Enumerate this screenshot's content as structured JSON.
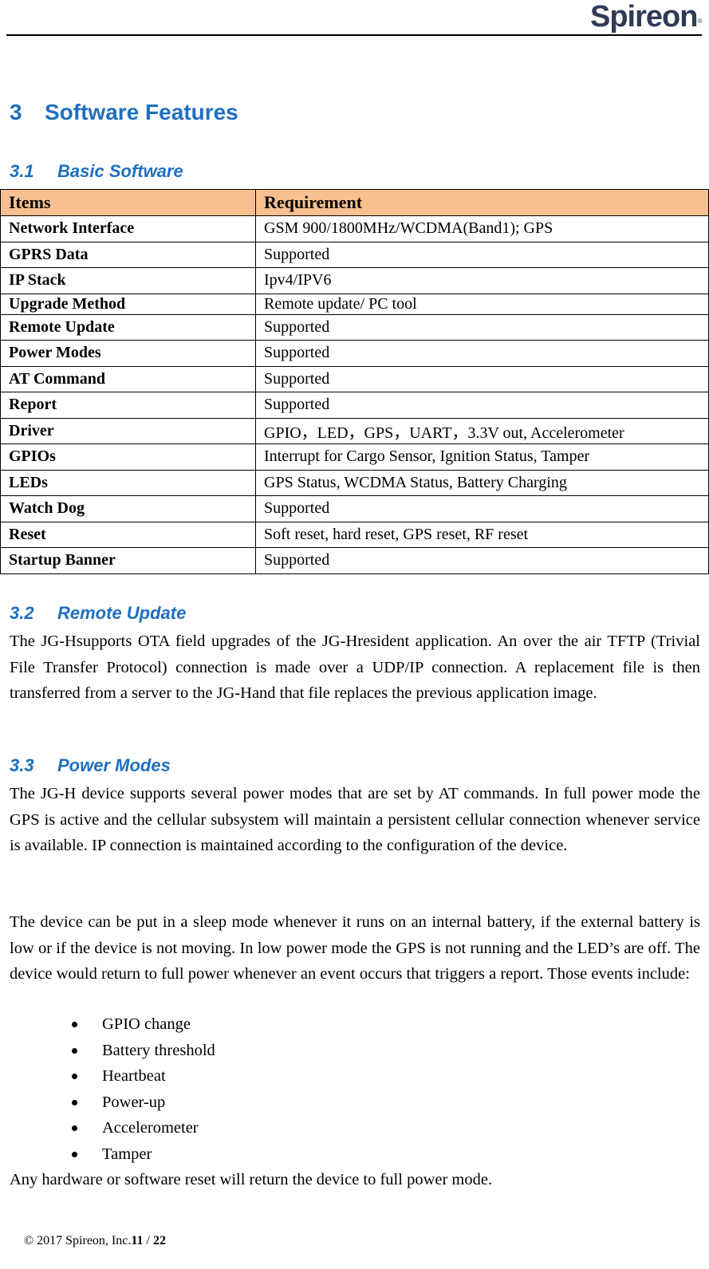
{
  "header": {
    "logo_text": "Spireon",
    "logo_accent_color": "#2f8fd1",
    "logo_color": "#2f3b55",
    "registered_mark": "®"
  },
  "section": {
    "number": "3",
    "title": "Software Features",
    "heading_color": "#1f6fbf"
  },
  "basic_software": {
    "number": "3.1",
    "title": "Basic Software",
    "table": {
      "header_color": "#f8c090",
      "columns": [
        "Items",
        "Requirement"
      ],
      "rows": [
        {
          "item": "Network Interface",
          "requirement": "GSM 900/1800MHz/WCDMA(Band1); GPS"
        },
        {
          "item": "GPRS Data",
          "requirement": "Supported"
        },
        {
          "item": "IP Stack",
          "requirement": "Ipv4/IPV6"
        },
        {
          "item": "Upgrade Method",
          "requirement": "Remote update/ PC tool"
        },
        {
          "item": "Remote Update",
          "requirement": "Supported"
        },
        {
          "item": "Power Modes",
          "requirement": "Supported"
        },
        {
          "item": "AT Command",
          "requirement": "Supported"
        },
        {
          "item": "Report",
          "requirement": "Supported"
        },
        {
          "item": "Driver",
          "requirement": "GPIO，LED，GPS，UART，3.3V out, Accelerometer"
        },
        {
          "item": "GPIOs",
          "requirement": "Interrupt for Cargo Sensor, Ignition Status, Tamper"
        },
        {
          "item": "LEDs",
          "requirement": "GPS Status, WCDMA Status, Battery Charging"
        },
        {
          "item": "Watch Dog",
          "requirement": "Supported"
        },
        {
          "item": "Reset",
          "requirement": "Soft reset, hard reset, GPS reset, RF reset"
        },
        {
          "item": "Startup Banner",
          "requirement": "Supported"
        }
      ]
    }
  },
  "remote_update": {
    "number": "3.2",
    "title": "Remote Update",
    "paragraph": "The JG-Hsupports OTA field upgrades of the JG-Hresident application. An over the air TFTP (Trivial File Transfer Protocol) connection is made over a UDP/IP connection. A replacement file is then transferred from a server to the JG-Hand that file replaces the previous application image."
  },
  "power_modes": {
    "number": "3.3",
    "title": "Power Modes",
    "paragraph1": "The JG-H device supports several power modes that are set by AT commands. In full power mode the GPS is active and the cellular subsystem will maintain a persistent cellular connection whenever service is available. IP connection is maintained according to the configuration of the device.",
    "paragraph2": "The device can be put in a sleep mode whenever it runs on an internal battery, if the external battery is low or if the device is not moving. In low power mode the GPS is not running and the LED’s are off. The device would return to full power whenever an event occurs that triggers a report. Those events include:",
    "events": [
      "GPIO change",
      "Battery threshold",
      "Heartbeat",
      "Power-up",
      "Accelerometer",
      "Tamper"
    ],
    "closing": "Any hardware or software reset will return the device to full power mode."
  },
  "footer": {
    "copyright": "© 2017 Spireon, Inc.",
    "page_current": "11",
    "page_separator": " / ",
    "page_total": "22"
  }
}
